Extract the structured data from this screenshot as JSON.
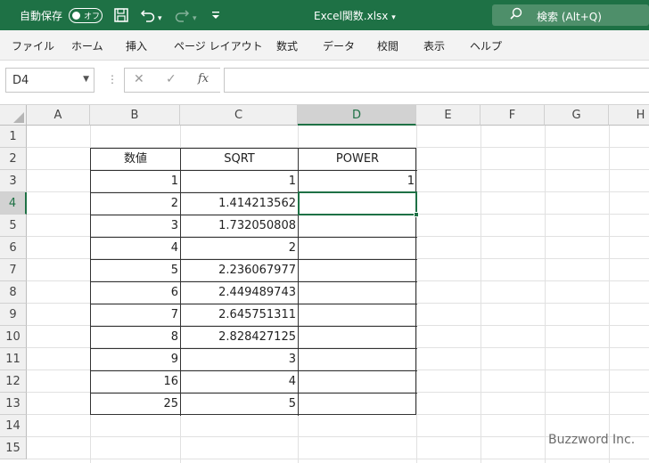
{
  "titlebar": {
    "autosave_label": "自動保存",
    "autosave_toggle": "オフ",
    "filename": "Excel関数.xlsx",
    "filename_caret": "▾",
    "search_text": "検索 (Alt+Q)"
  },
  "menu": [
    "ファイル",
    "ホーム",
    "挿入",
    "ページ レイアウト",
    "数式",
    "データ",
    "校閲",
    "表示",
    "ヘルプ"
  ],
  "formula_bar": {
    "name_box": "D4",
    "formula": ""
  },
  "columns": [
    "A",
    "B",
    "C",
    "D",
    "E",
    "F",
    "G",
    "H"
  ],
  "rows": [
    "1",
    "2",
    "3",
    "4",
    "5",
    "6",
    "7",
    "8",
    "9",
    "10",
    "11",
    "12",
    "13",
    "14",
    "15"
  ],
  "selected": {
    "column": "D",
    "row": "4"
  },
  "table": {
    "headers": [
      "数値",
      "SQRT",
      "POWER"
    ],
    "rows": [
      [
        "1",
        "1",
        "1"
      ],
      [
        "2",
        "1.414213562",
        ""
      ],
      [
        "3",
        "1.732050808",
        ""
      ],
      [
        "4",
        "2",
        ""
      ],
      [
        "5",
        "2.236067977",
        ""
      ],
      [
        "6",
        "2.449489743",
        ""
      ],
      [
        "7",
        "2.645751311",
        ""
      ],
      [
        "8",
        "2.828427125",
        ""
      ],
      [
        "9",
        "3",
        ""
      ],
      [
        "16",
        "4",
        ""
      ],
      [
        "25",
        "5",
        ""
      ]
    ]
  },
  "watermark": "Buzzword Inc.",
  "colors": {
    "excel_green": "#1e7145"
  }
}
